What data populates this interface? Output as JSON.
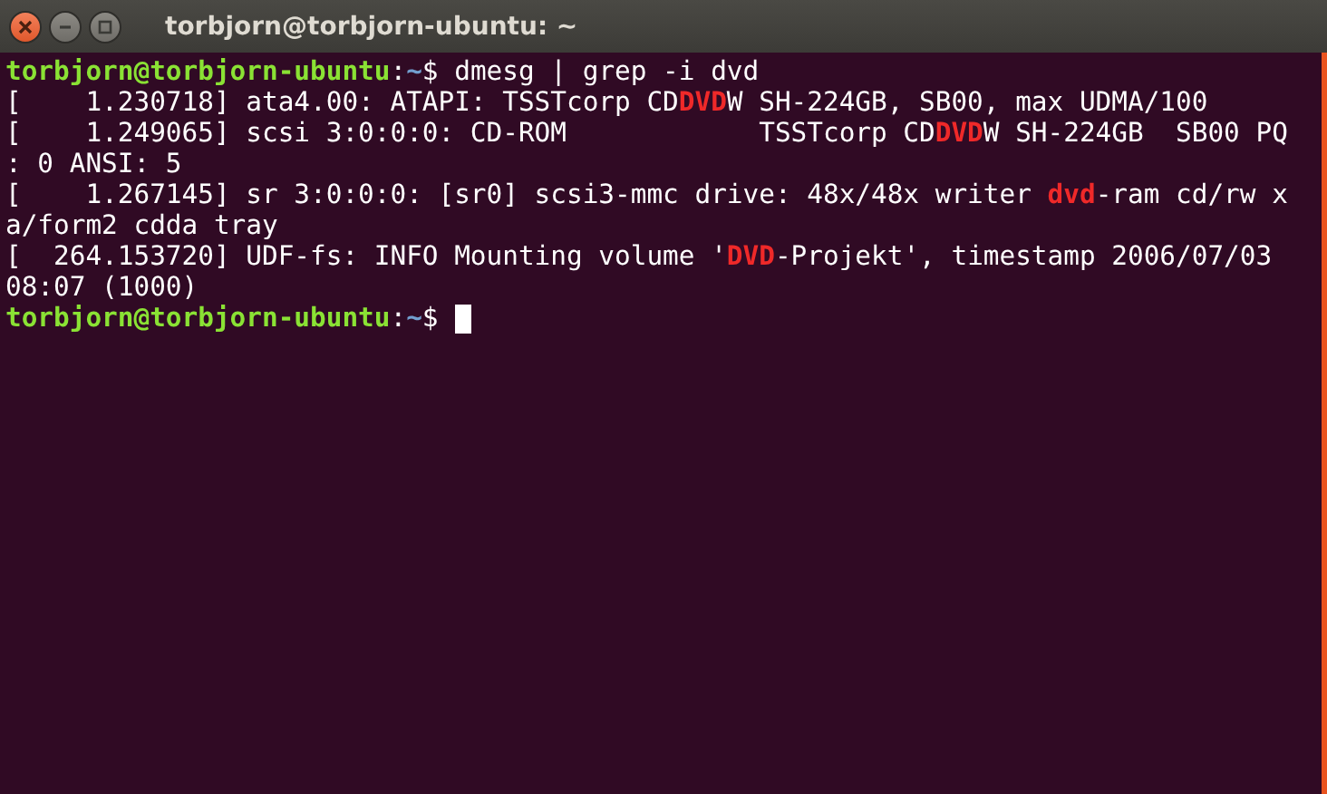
{
  "window": {
    "title": "torbjorn@torbjorn-ubuntu: ~"
  },
  "terminal": {
    "lines": [
      [
        {
          "kind": "user",
          "text": "torbjorn@torbjorn-ubuntu"
        },
        {
          "kind": "plain",
          "text": ":"
        },
        {
          "kind": "path",
          "text": "~"
        },
        {
          "kind": "plain",
          "text": "$ dmesg | grep -i dvd"
        }
      ],
      [
        {
          "kind": "plain",
          "text": "[    1.230718] ata4.00: ATAPI: TSSTcorp CD"
        },
        {
          "kind": "match",
          "text": "DVD"
        },
        {
          "kind": "plain",
          "text": "W SH-224GB, SB00, max UDMA/100"
        }
      ],
      [
        {
          "kind": "plain",
          "text": "[    1.249065] scsi 3:0:0:0: CD-ROM            TSSTcorp CD"
        },
        {
          "kind": "match",
          "text": "DVD"
        },
        {
          "kind": "plain",
          "text": "W SH-224GB  SB00 PQ"
        }
      ],
      [
        {
          "kind": "plain",
          "text": ": 0 ANSI: 5"
        }
      ],
      [
        {
          "kind": "plain",
          "text": "[    1.267145] sr 3:0:0:0: [sr0] scsi3-mmc drive: 48x/48x writer "
        },
        {
          "kind": "match",
          "text": "dvd"
        },
        {
          "kind": "plain",
          "text": "-ram cd/rw x"
        }
      ],
      [
        {
          "kind": "plain",
          "text": "a/form2 cdda tray"
        }
      ],
      [
        {
          "kind": "plain",
          "text": "[  264.153720] UDF-fs: INFO Mounting volume '"
        },
        {
          "kind": "match",
          "text": "DVD"
        },
        {
          "kind": "plain",
          "text": "-Projekt', timestamp 2006/07/03"
        }
      ],
      [
        {
          "kind": "plain",
          "text": "08:07 (1000)"
        }
      ],
      [
        {
          "kind": "user",
          "text": "torbjorn@torbjorn-ubuntu"
        },
        {
          "kind": "plain",
          "text": ":"
        },
        {
          "kind": "path",
          "text": "~"
        },
        {
          "kind": "plain",
          "text": "$ "
        }
      ]
    ],
    "cursor_visible": true
  }
}
